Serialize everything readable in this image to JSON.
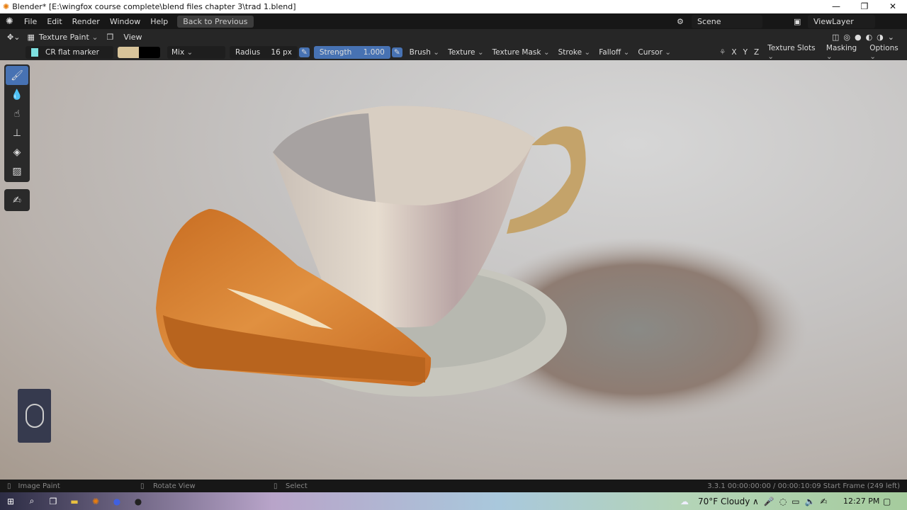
{
  "window": {
    "title": "Blender* [E:\\wingfox course complete\\blend files chapter 3\\trad 1.blend]",
    "minimize": "—",
    "maximize": "❐",
    "close": "✕"
  },
  "menu": {
    "items": [
      "File",
      "Edit",
      "Render",
      "Window",
      "Help"
    ],
    "back": "Back to Previous",
    "scene": "Scene",
    "view_layer": "ViewLayer"
  },
  "header": {
    "mode": "Texture Paint",
    "view": "View"
  },
  "toolsettings": {
    "brush_name": "CR flat marker",
    "primary_color": "#d8c49a",
    "secondary_color": "#000000",
    "blend": "Mix",
    "radius_label": "Radius",
    "radius_value": "16 px",
    "strength_label": "Strength",
    "strength_value": "1.000",
    "menus": [
      "Brush",
      "Texture",
      "Texture Mask",
      "Stroke",
      "Falloff",
      "Cursor"
    ],
    "axes": [
      "X",
      "Y",
      "Z"
    ],
    "right_menus": [
      "Texture Slots",
      "Masking",
      "Options"
    ]
  },
  "toolbar": {
    "tools": [
      "draw-icon",
      "soften-icon",
      "smear-icon",
      "clone-icon",
      "fill-icon",
      "mask-icon",
      "annotate-icon"
    ]
  },
  "status": {
    "left": "Image Paint",
    "middle": "Rotate View",
    "right": "Select",
    "info": "3.3.1  00:00:00:00 / 00:00:10:09  Start Frame (249 left)"
  },
  "taskbar": {
    "weather": "70°F  Cloudy",
    "time": "12:27 PM"
  }
}
